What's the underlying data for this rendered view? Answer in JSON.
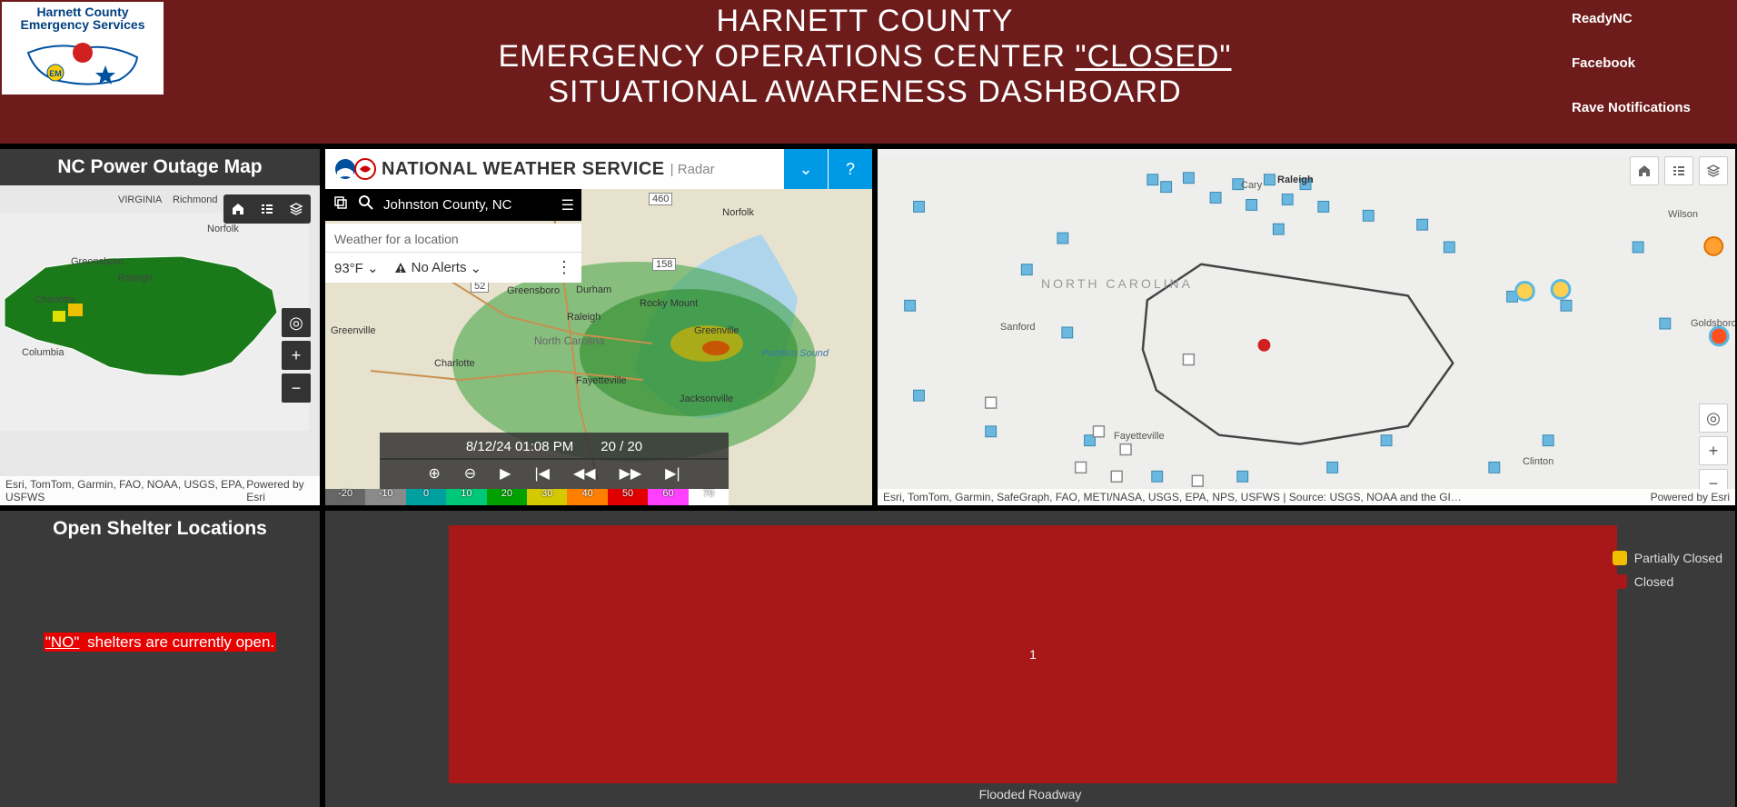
{
  "header": {
    "logo_line1": "Harnett County",
    "logo_line2": "Emergency Services",
    "title_line1": "HARNETT COUNTY",
    "title_line2_a": "EMERGENCY OPERATIONS CENTER ",
    "title_line2_b": "\"CLOSED\"",
    "title_line3": "SITUATIONAL AWARENESS DASHBOARD",
    "links": [
      "ReadyNC",
      "Facebook",
      "Rave Notifications"
    ]
  },
  "power_outage": {
    "title": "NC Power Outage Map",
    "attribution_left": "Esri, TomTom, Garmin, FAO, NOAA, USGS, EPA, USFWS",
    "attribution_right": "Powered by Esri",
    "labels": {
      "virginia": "VIRGINIA",
      "richmond": "Richmond",
      "norfolk": "Norfolk",
      "greensboro": "Greensboro",
      "raleigh": "Raleigh",
      "charlotte": "Charlotte",
      "columbia": "Columbia"
    }
  },
  "shelter": {
    "title": "Open Shelter Locations",
    "no_text": "\"NO\"",
    "rest_text": " shelters are currently open."
  },
  "nws": {
    "title": "NATIONAL WEATHER SERVICE",
    "subtitle": "Radar",
    "search_text": "Johnston County, NC",
    "wx_prompt": "Weather for a location",
    "temp": "93°F",
    "alerts": "No Alerts",
    "timeline_time": "8/12/24 01:08 PM",
    "timeline_frame": "20 / 20",
    "scale": [
      {
        "v": "-20",
        "c": "#666666"
      },
      {
        "v": "-10",
        "c": "#8a8a8a"
      },
      {
        "v": "0",
        "c": "#00a0a0"
      },
      {
        "v": "10",
        "c": "#00c878"
      },
      {
        "v": "20",
        "c": "#00a000"
      },
      {
        "v": "30",
        "c": "#d4c800"
      },
      {
        "v": "40",
        "c": "#ff8000"
      },
      {
        "v": "50",
        "c": "#e00000"
      },
      {
        "v": "60",
        "c": "#ff40ff"
      },
      {
        "v": "70",
        "c": "#ffffff"
      }
    ],
    "map_labels": {
      "norfolk": "Norfolk",
      "greensboro": "Greensboro",
      "durham": "Durham",
      "raleigh": "Raleigh",
      "rockymount": "Rocky Mount",
      "greenville": "Greenville",
      "charlotte": "Charlotte",
      "nc": "North Carolina",
      "fayetteville": "Fayetteville",
      "jacksonville": "Jacksonville",
      "greenvillesc": "Greenville",
      "pamlico": "Pamlico Sound",
      "r460": "460",
      "r158": "158",
      "r52": "52"
    }
  },
  "right_map": {
    "attribution_left": "Esri, TomTom, Garmin, SafeGraph, FAO, METI/NASA, USGS, EPA, NPS, USFWS | Source: USGS, NOAA and the GI…",
    "attribution_right": "Powered by Esri",
    "labels": {
      "raleigh": "Raleigh",
      "cary": "Cary",
      "wilson": "Wilson",
      "sanford": "Sanford",
      "goldsboro": "Goldsboro",
      "fayetteville": "Fayetteville",
      "clinton": "Clinton",
      "nc": "NORTH CAROLINA"
    }
  },
  "chart_data": {
    "type": "bar",
    "categories": [
      "Flooded Roadway"
    ],
    "series": [
      {
        "name": "Partially Closed",
        "color": "#f0c000",
        "values": [
          0
        ]
      },
      {
        "name": "Closed",
        "color": "#a81818",
        "values": [
          1
        ]
      }
    ],
    "value_label": "1",
    "xlabel": "Flooded Roadway"
  }
}
